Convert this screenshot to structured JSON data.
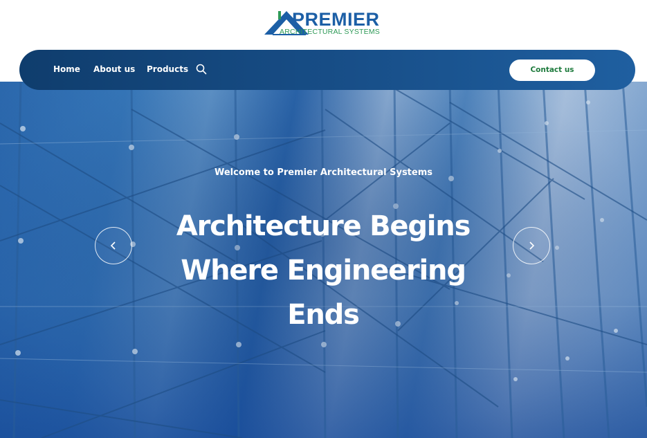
{
  "brand": {
    "name": "PREMIER",
    "tagline": "ARCHITECTURAL SYSTEMS",
    "primary_color": "#1c5fa6",
    "accent_color": "#2e9a57",
    "logo_icon": "roof-triangle-logo-icon"
  },
  "nav": {
    "items": [
      {
        "label": "Home"
      },
      {
        "label": "About us"
      },
      {
        "label": "Products"
      }
    ],
    "search_icon": "search-icon",
    "contact_label": "Contact us",
    "background_color": "#174d86"
  },
  "hero": {
    "welcome": "Welcome to Premier Architectural Systems",
    "headline_lines": [
      "Architecture Begins",
      "Where Engineering",
      "Ends"
    ],
    "prev_icon": "chevron-left-icon",
    "next_icon": "chevron-right-icon",
    "background": "glass-facade-photo"
  }
}
